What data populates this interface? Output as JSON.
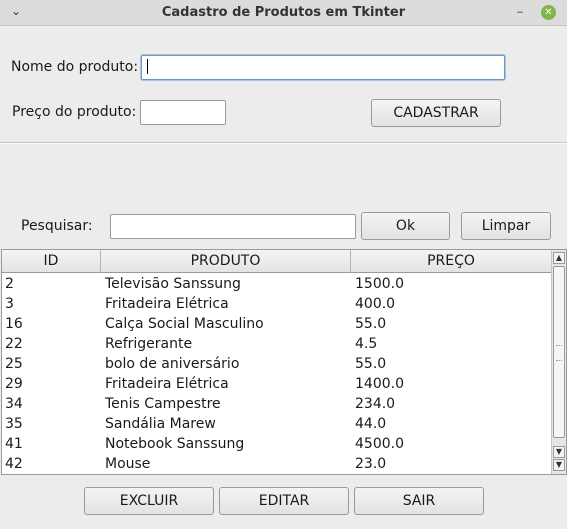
{
  "window": {
    "title": "Cadastro de Produtos em Tkinter",
    "menu_glyph": "⌄",
    "minimize_glyph": "‒",
    "close_glyph": "✕"
  },
  "form": {
    "name_label": "Nome do produto:",
    "name_value": "",
    "price_label": "Preço do produto:",
    "price_value": "",
    "register_button": "CADASTRAR"
  },
  "search": {
    "label": "Pesquisar:",
    "value": "",
    "ok_button": "Ok",
    "clear_button": "Limpar"
  },
  "table": {
    "columns": [
      "ID",
      "PRODUTO",
      "PREÇO"
    ],
    "rows": [
      [
        "2",
        "Televisão Sanssung",
        "1500.0"
      ],
      [
        "3",
        "Fritadeira Elétrica",
        "400.0"
      ],
      [
        "16",
        "Calça Social Masculino",
        "55.0"
      ],
      [
        "22",
        "Refrigerante",
        "4.5"
      ],
      [
        "25",
        "bolo de aniversário",
        "55.0"
      ],
      [
        "29",
        "Fritadeira Elétrica",
        "1400.0"
      ],
      [
        "34",
        "Tenis Campestre",
        "234.0"
      ],
      [
        "35",
        "Sandália Marew",
        "44.0"
      ],
      [
        "41",
        "Notebook Sanssung",
        "4500.0"
      ],
      [
        "42",
        "Mouse",
        "23.0"
      ]
    ]
  },
  "actions": {
    "delete_button": "EXCLUIR",
    "edit_button": "EDITAR",
    "exit_button": "SAIR"
  },
  "colors": {
    "window_bg": "#ececec",
    "focus_border": "#6d98c4",
    "close_button": "#7fb647"
  }
}
